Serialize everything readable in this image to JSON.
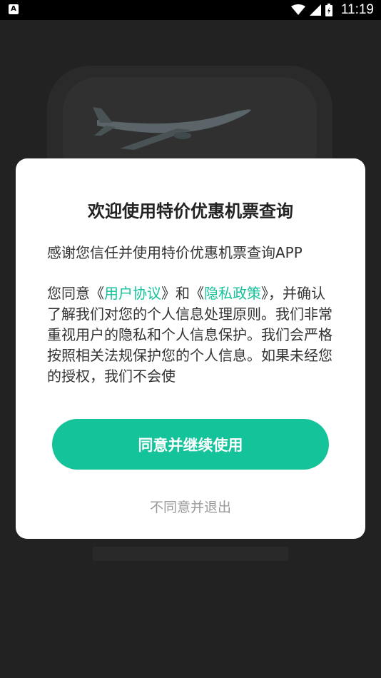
{
  "status_bar": {
    "app_icon_letter": "A",
    "time": "11:19"
  },
  "dialog": {
    "title": "欢迎使用特价优惠机票查询",
    "intro": "感谢您信任并使用特价优惠机票查询APP",
    "body_prefix": "您同意《",
    "user_agreement_link": "用户协议",
    "body_middle": "》和《",
    "privacy_policy_link": "隐私政策",
    "body_suffix": "》，并确认了解我们对您的个人信息处理原则。我们非常重视用户的隐私和个人信息保护。我们会严格按照相关法规保护您的个人信息。如果未经您的授权，我们不会使",
    "agree_button": "同意并继续使用",
    "disagree_link": "不同意并退出"
  },
  "colors": {
    "accent": "#15c39a",
    "background": "#2a2a2a",
    "dialog_background": "#ffffff"
  }
}
